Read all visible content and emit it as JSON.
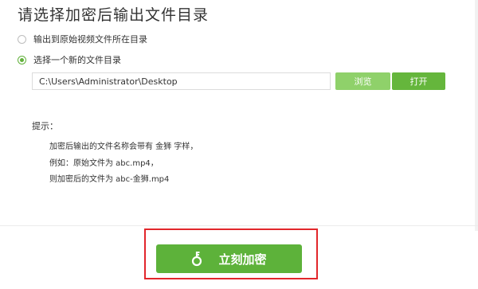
{
  "title": "请选择加密后输出文件目录",
  "options": [
    {
      "label": "输出到原始视频文件所在目录",
      "checked": false
    },
    {
      "label": "选择一个新的文件目录",
      "checked": true
    }
  ],
  "path_input": {
    "value": "C:\\Users\\Administrator\\Desktop"
  },
  "buttons": {
    "browse": "浏览",
    "open": "打开",
    "encrypt": "立刻加密"
  },
  "hint": {
    "title": "提示：",
    "lines": [
      "加密后输出的文件名称会带有 金狮 字样，",
      "例如：原始文件为  abc.mp4，",
      "则加密后的文件为 abc-金狮.mp4"
    ]
  },
  "colors": {
    "accent_green": "#5db23a",
    "browse_green": "#8fd16a",
    "highlight_red": "#e2262b"
  },
  "icons": {
    "encrypt": "key-icon"
  }
}
